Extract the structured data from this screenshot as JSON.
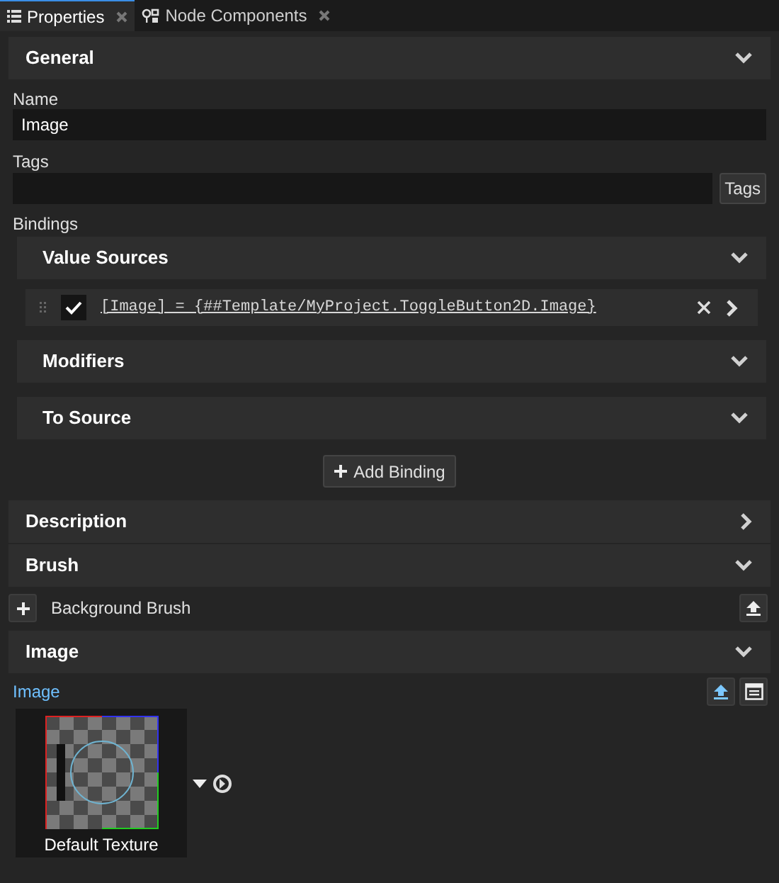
{
  "tabs": [
    {
      "label": "Properties",
      "kind": "list",
      "selected": true
    },
    {
      "label": "Node Components",
      "kind": "components",
      "selected": false
    }
  ],
  "general": {
    "title": "General",
    "expanded": true,
    "name_label": "Name",
    "name_value": "Image",
    "tags_label": "Tags",
    "tags_button": "Tags",
    "bindings_label": "Bindings",
    "binding_groups": [
      {
        "title": "Value Sources",
        "expanded": true,
        "bindings": [
          {
            "checked": true,
            "expression": "[Image] = {##Template/MyProject.ToggleButton2D.Image}"
          }
        ]
      },
      {
        "title": "Modifiers",
        "expanded": true
      },
      {
        "title": "To Source",
        "expanded": true
      }
    ],
    "add_binding": "Add Binding"
  },
  "sections": [
    {
      "title": "Description",
      "expanded": false
    },
    {
      "title": "Brush",
      "expanded": true,
      "properties": [
        {
          "label": "Background Brush"
        }
      ]
    },
    {
      "title": "Image",
      "expanded": true,
      "image_property": {
        "label": "Image",
        "texture_name": "Default Texture"
      }
    }
  ]
}
